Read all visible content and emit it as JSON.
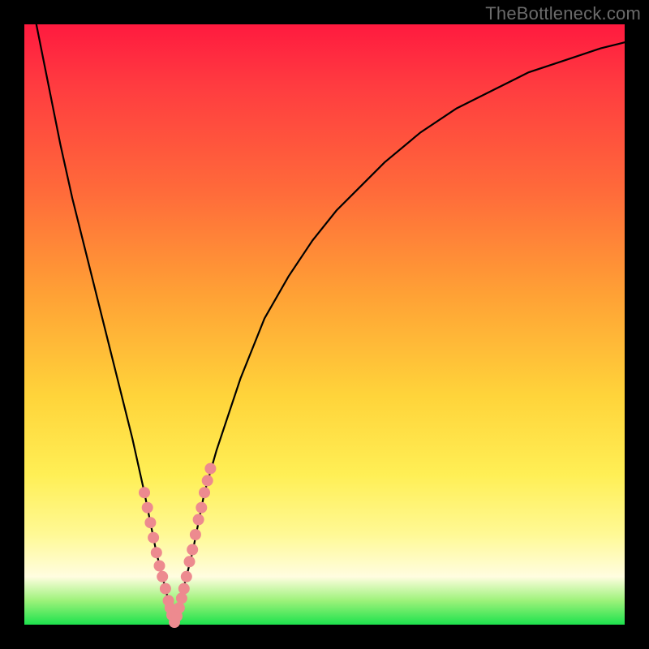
{
  "watermark": "TheBottleneck.com",
  "colors": {
    "gradient_top": "#ff1a3f",
    "gradient_mid1": "#ff6b3a",
    "gradient_mid2": "#ffd43a",
    "gradient_mid3": "#fffde0",
    "gradient_bottom": "#1de24d",
    "curve": "#000000",
    "dots": "#ed8a8f",
    "frame": "#000000"
  },
  "chart_data": {
    "type": "line",
    "title": "",
    "xlabel": "",
    "ylabel": "",
    "xlim": [
      0,
      100
    ],
    "ylim": [
      0,
      100
    ],
    "notch_x": 25,
    "series": [
      {
        "name": "bottleneck-curve",
        "x": [
          2,
          4,
          6,
          8,
          10,
          12,
          14,
          16,
          18,
          20,
          21,
          22,
          23,
          24,
          25,
          26,
          27,
          28,
          29,
          30,
          32,
          34,
          36,
          38,
          40,
          44,
          48,
          52,
          56,
          60,
          66,
          72,
          78,
          84,
          90,
          96,
          100
        ],
        "values": [
          100,
          90,
          80,
          71,
          63,
          55,
          47,
          39,
          31,
          22,
          17,
          12,
          8,
          4,
          0,
          4,
          8,
          12,
          17,
          22,
          29,
          35,
          41,
          46,
          51,
          58,
          64,
          69,
          73,
          77,
          82,
          86,
          89,
          92,
          94,
          96,
          97
        ]
      }
    ],
    "data_points": {
      "name": "sample-dots",
      "x": [
        20.0,
        20.5,
        21.0,
        21.5,
        22.0,
        22.5,
        23.0,
        23.5,
        24.0,
        24.3,
        24.6,
        25.0,
        25.4,
        25.8,
        26.2,
        26.6,
        27.0,
        27.5,
        28.0,
        28.5,
        29.0,
        29.5,
        30.0,
        30.5,
        31.0
      ],
      "values": [
        22.0,
        19.5,
        17.0,
        14.5,
        12.0,
        9.8,
        8.0,
        6.0,
        4.0,
        2.8,
        1.6,
        0.4,
        1.4,
        2.8,
        4.4,
        6.0,
        8.0,
        10.5,
        12.5,
        15.0,
        17.5,
        19.5,
        22.0,
        24.0,
        26.0
      ]
    }
  }
}
